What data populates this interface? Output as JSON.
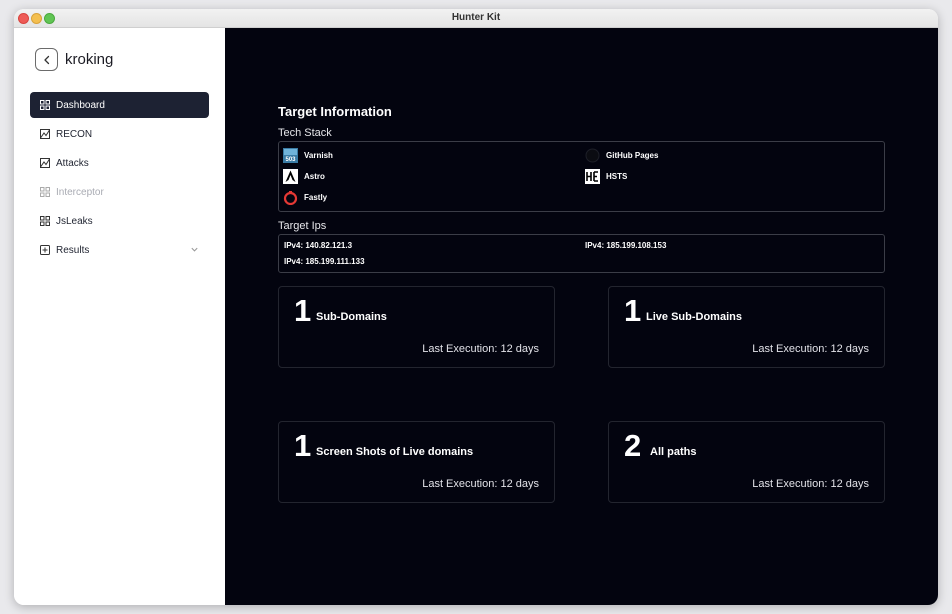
{
  "window": {
    "title": "Hunter Kit"
  },
  "sidebar": {
    "project_name": "kroking",
    "items": [
      {
        "label": "Dashboard",
        "icon": "grid-icon",
        "state": "active"
      },
      {
        "label": "RECON",
        "icon": "activity-icon",
        "state": "normal"
      },
      {
        "label": "Attacks",
        "icon": "activity-icon",
        "state": "normal"
      },
      {
        "label": "Interceptor",
        "icon": "grid-icon",
        "state": "disabled"
      },
      {
        "label": "JsLeaks",
        "icon": "grid-icon",
        "state": "normal"
      },
      {
        "label": "Results",
        "icon": "plus-square-icon",
        "state": "normal",
        "expandable": true
      }
    ]
  },
  "main": {
    "section_title": "Target Information",
    "tech_stack_title": "Tech Stack",
    "tech_stack": [
      {
        "name": "Varnish",
        "icon": "varnish-logo"
      },
      {
        "name": "GitHub Pages",
        "icon": "github-logo"
      },
      {
        "name": "Astro",
        "icon": "astro-logo"
      },
      {
        "name": "HSTS",
        "icon": "hsts-logo"
      },
      {
        "name": "Fastly",
        "icon": "fastly-logo"
      }
    ],
    "target_ips_title": "Target Ips",
    "target_ips": [
      "IPv4: 140.82.121.3",
      "IPv4: 185.199.108.153",
      "IPv4: 185.199.111.133"
    ],
    "cards": [
      {
        "count": "1",
        "label": "Sub-Domains",
        "last_execution": "Last Execution: 12 days"
      },
      {
        "count": "1",
        "label": "Live Sub-Domains",
        "last_execution": "Last Execution: 12 days"
      },
      {
        "count": "1",
        "label": "Screen Shots of Live domains",
        "last_execution": "Last Execution: 12 days"
      },
      {
        "count": "2",
        "label": "All paths",
        "last_execution": "Last Execution: 12 days"
      }
    ]
  },
  "colors": {
    "main_background": "#03040f",
    "active_nav": "#1d2233",
    "card_border": "#23252f"
  }
}
